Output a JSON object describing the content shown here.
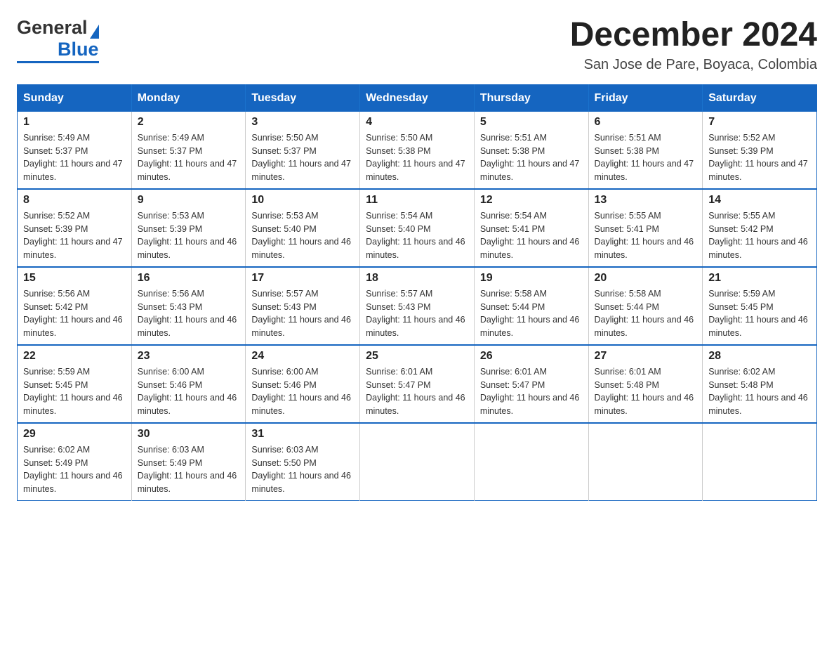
{
  "header": {
    "logo_general": "General",
    "logo_blue": "Blue",
    "month_title": "December 2024",
    "location": "San Jose de Pare, Boyaca, Colombia"
  },
  "weekdays": [
    "Sunday",
    "Monday",
    "Tuesday",
    "Wednesday",
    "Thursday",
    "Friday",
    "Saturday"
  ],
  "weeks": [
    [
      {
        "day": "1",
        "sunrise": "5:49 AM",
        "sunset": "5:37 PM",
        "daylight": "11 hours and 47 minutes."
      },
      {
        "day": "2",
        "sunrise": "5:49 AM",
        "sunset": "5:37 PM",
        "daylight": "11 hours and 47 minutes."
      },
      {
        "day": "3",
        "sunrise": "5:50 AM",
        "sunset": "5:37 PM",
        "daylight": "11 hours and 47 minutes."
      },
      {
        "day": "4",
        "sunrise": "5:50 AM",
        "sunset": "5:38 PM",
        "daylight": "11 hours and 47 minutes."
      },
      {
        "day": "5",
        "sunrise": "5:51 AM",
        "sunset": "5:38 PM",
        "daylight": "11 hours and 47 minutes."
      },
      {
        "day": "6",
        "sunrise": "5:51 AM",
        "sunset": "5:38 PM",
        "daylight": "11 hours and 47 minutes."
      },
      {
        "day": "7",
        "sunrise": "5:52 AM",
        "sunset": "5:39 PM",
        "daylight": "11 hours and 47 minutes."
      }
    ],
    [
      {
        "day": "8",
        "sunrise": "5:52 AM",
        "sunset": "5:39 PM",
        "daylight": "11 hours and 47 minutes."
      },
      {
        "day": "9",
        "sunrise": "5:53 AM",
        "sunset": "5:39 PM",
        "daylight": "11 hours and 46 minutes."
      },
      {
        "day": "10",
        "sunrise": "5:53 AM",
        "sunset": "5:40 PM",
        "daylight": "11 hours and 46 minutes."
      },
      {
        "day": "11",
        "sunrise": "5:54 AM",
        "sunset": "5:40 PM",
        "daylight": "11 hours and 46 minutes."
      },
      {
        "day": "12",
        "sunrise": "5:54 AM",
        "sunset": "5:41 PM",
        "daylight": "11 hours and 46 minutes."
      },
      {
        "day": "13",
        "sunrise": "5:55 AM",
        "sunset": "5:41 PM",
        "daylight": "11 hours and 46 minutes."
      },
      {
        "day": "14",
        "sunrise": "5:55 AM",
        "sunset": "5:42 PM",
        "daylight": "11 hours and 46 minutes."
      }
    ],
    [
      {
        "day": "15",
        "sunrise": "5:56 AM",
        "sunset": "5:42 PM",
        "daylight": "11 hours and 46 minutes."
      },
      {
        "day": "16",
        "sunrise": "5:56 AM",
        "sunset": "5:43 PM",
        "daylight": "11 hours and 46 minutes."
      },
      {
        "day": "17",
        "sunrise": "5:57 AM",
        "sunset": "5:43 PM",
        "daylight": "11 hours and 46 minutes."
      },
      {
        "day": "18",
        "sunrise": "5:57 AM",
        "sunset": "5:43 PM",
        "daylight": "11 hours and 46 minutes."
      },
      {
        "day": "19",
        "sunrise": "5:58 AM",
        "sunset": "5:44 PM",
        "daylight": "11 hours and 46 minutes."
      },
      {
        "day": "20",
        "sunrise": "5:58 AM",
        "sunset": "5:44 PM",
        "daylight": "11 hours and 46 minutes."
      },
      {
        "day": "21",
        "sunrise": "5:59 AM",
        "sunset": "5:45 PM",
        "daylight": "11 hours and 46 minutes."
      }
    ],
    [
      {
        "day": "22",
        "sunrise": "5:59 AM",
        "sunset": "5:45 PM",
        "daylight": "11 hours and 46 minutes."
      },
      {
        "day": "23",
        "sunrise": "6:00 AM",
        "sunset": "5:46 PM",
        "daylight": "11 hours and 46 minutes."
      },
      {
        "day": "24",
        "sunrise": "6:00 AM",
        "sunset": "5:46 PM",
        "daylight": "11 hours and 46 minutes."
      },
      {
        "day": "25",
        "sunrise": "6:01 AM",
        "sunset": "5:47 PM",
        "daylight": "11 hours and 46 minutes."
      },
      {
        "day": "26",
        "sunrise": "6:01 AM",
        "sunset": "5:47 PM",
        "daylight": "11 hours and 46 minutes."
      },
      {
        "day": "27",
        "sunrise": "6:01 AM",
        "sunset": "5:48 PM",
        "daylight": "11 hours and 46 minutes."
      },
      {
        "day": "28",
        "sunrise": "6:02 AM",
        "sunset": "5:48 PM",
        "daylight": "11 hours and 46 minutes."
      }
    ],
    [
      {
        "day": "29",
        "sunrise": "6:02 AM",
        "sunset": "5:49 PM",
        "daylight": "11 hours and 46 minutes."
      },
      {
        "day": "30",
        "sunrise": "6:03 AM",
        "sunset": "5:49 PM",
        "daylight": "11 hours and 46 minutes."
      },
      {
        "day": "31",
        "sunrise": "6:03 AM",
        "sunset": "5:50 PM",
        "daylight": "11 hours and 46 minutes."
      },
      null,
      null,
      null,
      null
    ]
  ],
  "labels": {
    "sunrise_prefix": "Sunrise: ",
    "sunset_prefix": "Sunset: ",
    "daylight_prefix": "Daylight: "
  }
}
